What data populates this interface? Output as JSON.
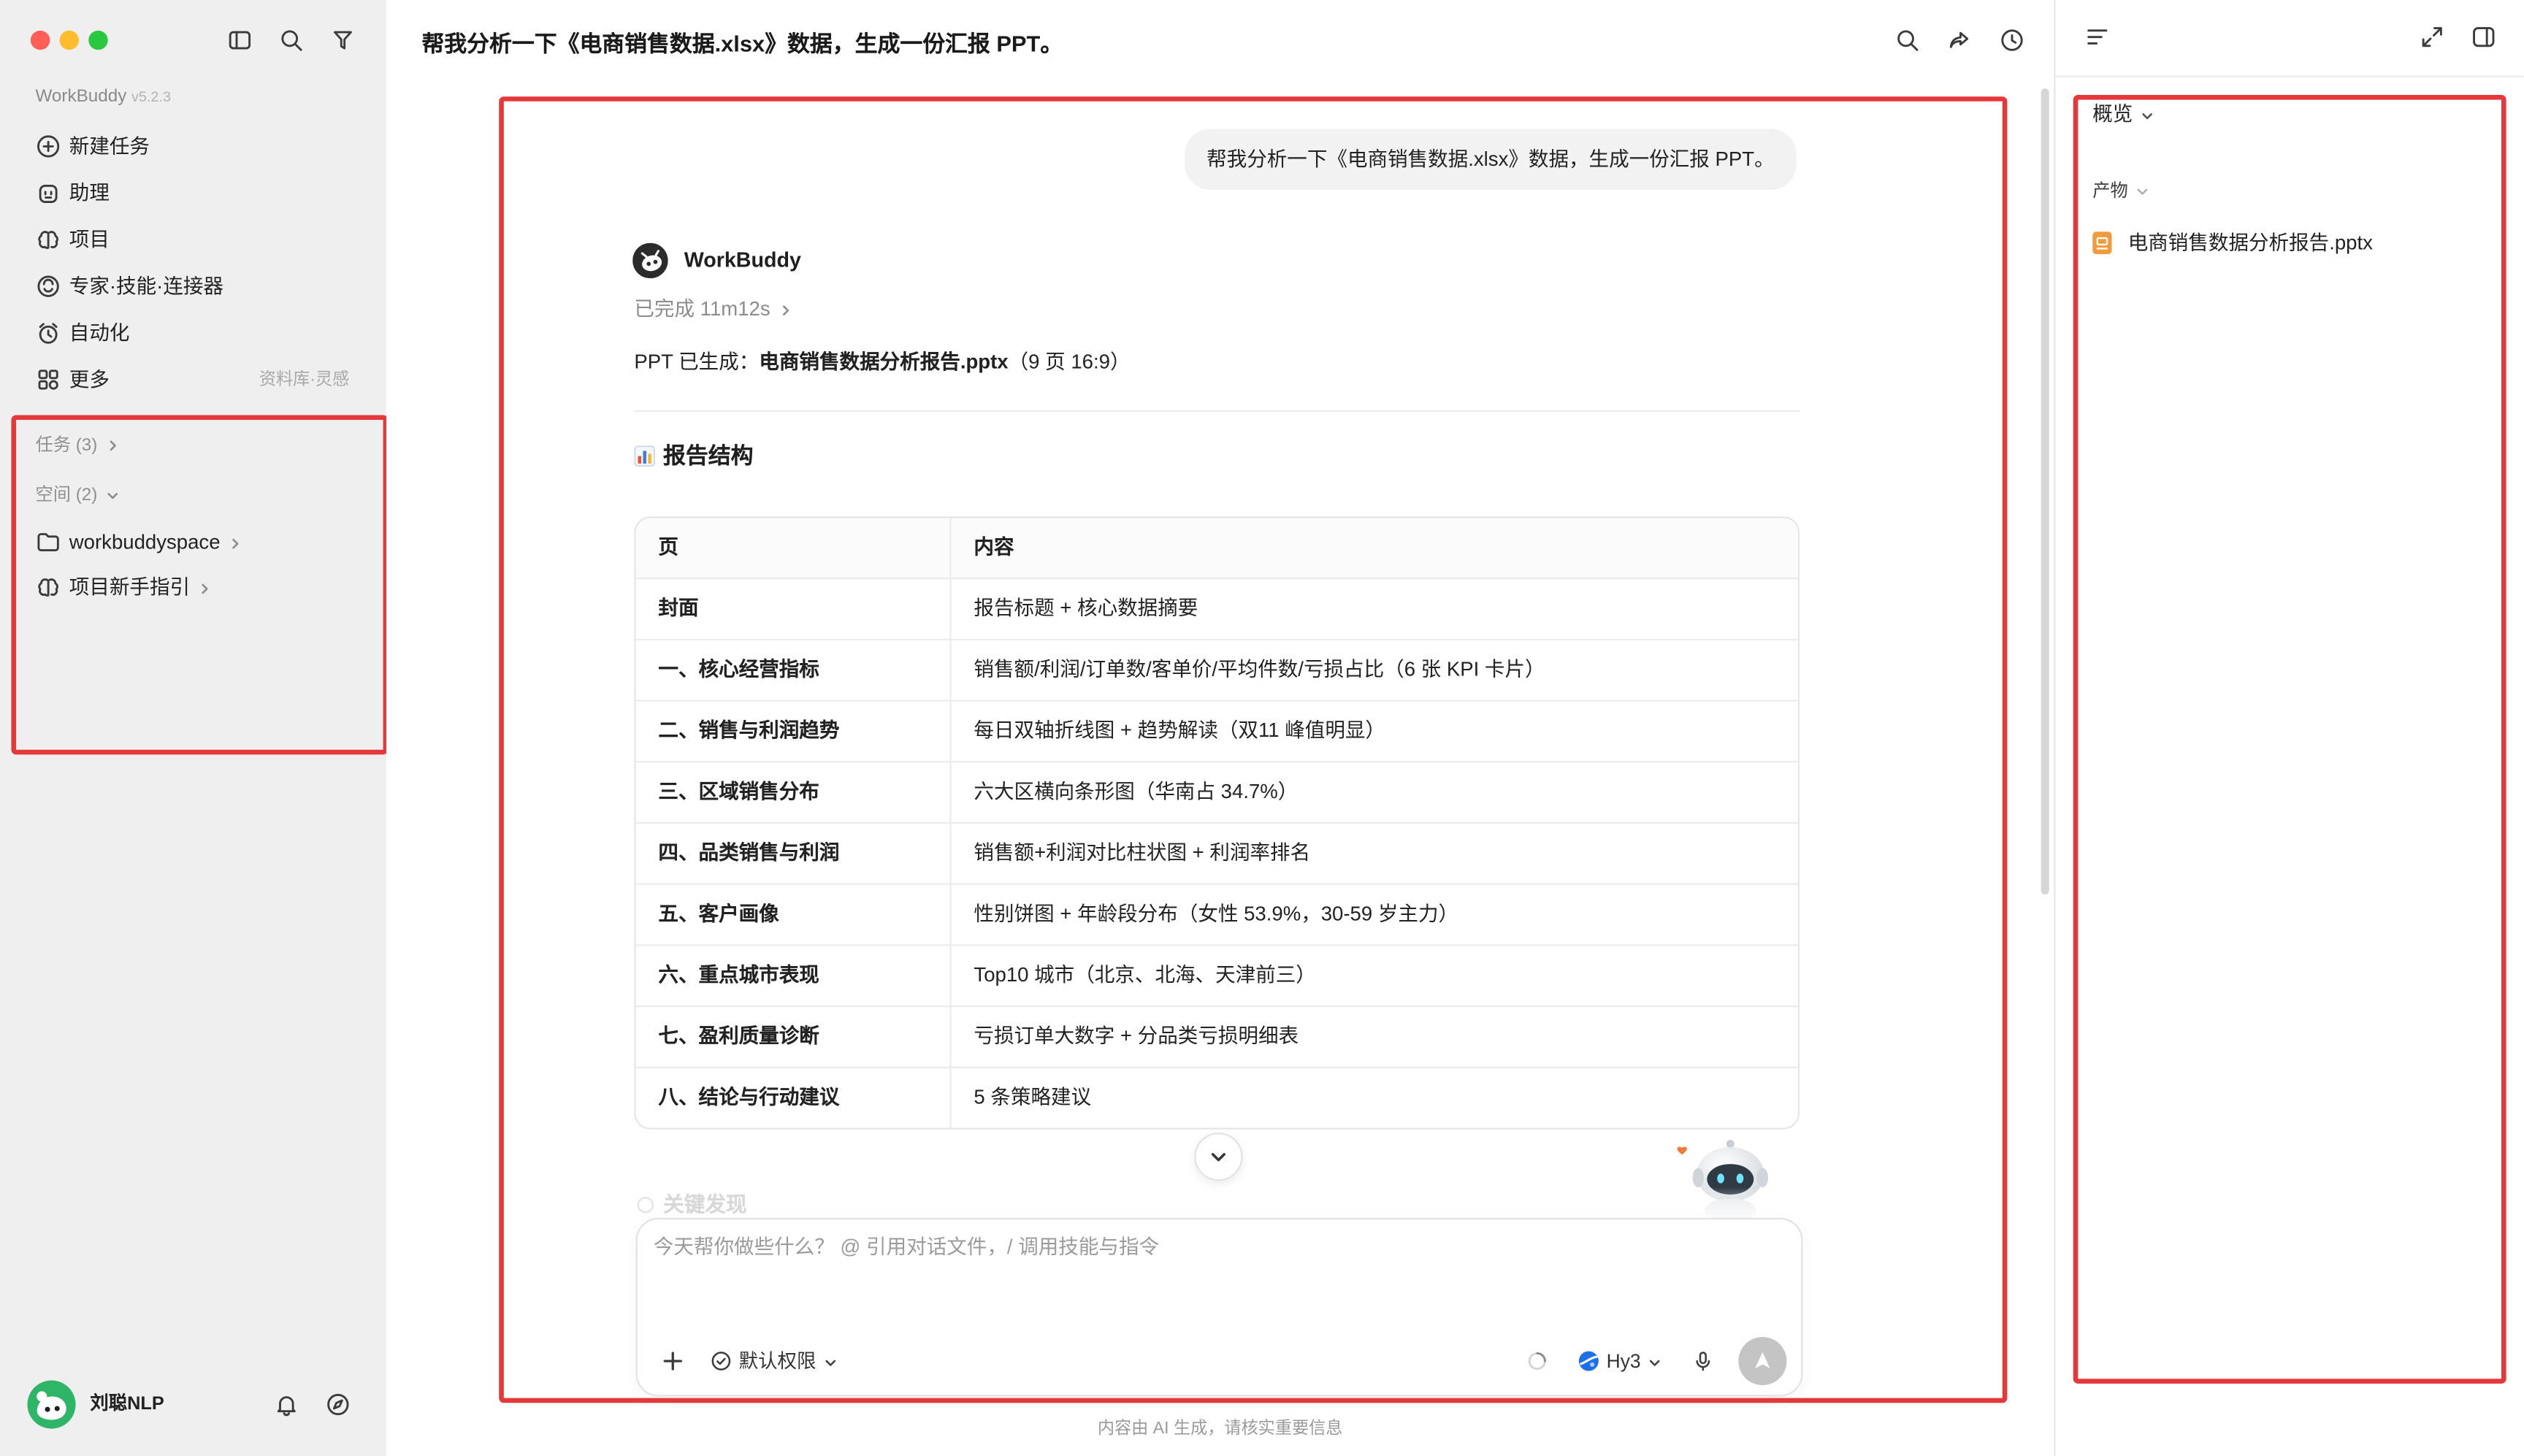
{
  "colors": {
    "highlight_red": "#e5383b",
    "sidebar_bg": "#efefef",
    "traffic_close": "#ff5f57",
    "traffic_minimize": "#febc2e",
    "traffic_zoom": "#28c840",
    "user_bubble_bg": "#f2f2f2",
    "file_icon_orange": "#f39a3c",
    "model_icon_blue": "#1f6feb",
    "send_button_gray": "#c4c4c4",
    "avatar_green": "#2fb567"
  },
  "sidebar": {
    "app_name": "WorkBuddy",
    "version": "v5.2.3",
    "toolbar_icons": [
      "sidebar-toggle-icon",
      "search-icon",
      "filter-icon"
    ],
    "nav": [
      {
        "label": "新建任务",
        "icon": "plus-circle-icon"
      },
      {
        "label": "助理",
        "icon": "assistant-icon"
      },
      {
        "label": "项目",
        "icon": "project-icon"
      },
      {
        "label": "专家·技能·连接器",
        "icon": "expert-icon"
      },
      {
        "label": "自动化",
        "icon": "alarm-clock-icon"
      },
      {
        "label": "更多",
        "icon": "grid-icon",
        "hint": "资料库·灵感"
      }
    ],
    "tasks_label": "任务 (3)",
    "spaces_label": "空间 (2)",
    "spaces": [
      {
        "label": "workbuddyspace",
        "icon": "folder-icon"
      },
      {
        "label": "项目新手指引",
        "icon": "project-icon"
      }
    ],
    "user": {
      "name": "刘聪NLP",
      "icons": [
        "bell-icon",
        "compass-icon"
      ]
    }
  },
  "header": {
    "title": "帮我分析一下《电商销售数据.xlsx》数据，生成一份汇报 PPT。",
    "icons": [
      "search-icon",
      "share-icon",
      "history-icon"
    ]
  },
  "chat": {
    "user_message": "帮我分析一下《电商销售数据.xlsx》数据，生成一份汇报 PPT。",
    "assistant_name": "WorkBuddy",
    "status": "已完成 11m12s",
    "result_prefix": "PPT 已生成：",
    "result_file": "电商销售数据分析报告.pptx",
    "result_suffix": "（9 页 16:9）",
    "section_icon": "bar-chart-icon",
    "section_title": "报告结构",
    "table": {
      "headers": [
        "页",
        "内容"
      ],
      "rows": [
        [
          "封面",
          "报告标题 + 核心数据摘要"
        ],
        [
          "一、核心经营指标",
          "销售额/利润/订单数/客单价/平均件数/亏损占比（6 张 KPI 卡片）"
        ],
        [
          "二、销售与利润趋势",
          "每日双轴折线图 + 趋势解读（双11 峰值明显）"
        ],
        [
          "三、区域销售分布",
          "六大区横向条形图（华南占 34.7%）"
        ],
        [
          "四、品类销售与利润",
          "销售额+利润对比柱状图 + 利润率排名"
        ],
        [
          "五、客户画像",
          "性别饼图 + 年龄段分布（女性 53.9%，30-59 岁主力）"
        ],
        [
          "六、重点城市表现",
          "Top10 城市（北京、北海、天津前三）"
        ],
        [
          "七、盈利质量诊断",
          "亏损订单大数字 + 分品类亏损明细表"
        ],
        [
          "八、结论与行动建议",
          "5 条策略建议"
        ]
      ]
    },
    "faded_next_heading": "关键发现"
  },
  "composer": {
    "placeholder": "今天帮你做些什么？ @ 引用对话文件，/ 调用技能与指令",
    "permission_label": "默认权限",
    "model_label": "Hy3"
  },
  "footer": {
    "disclaimer": "内容由 AI 生成，请核实重要信息"
  },
  "right_panel": {
    "overview_label": "概览",
    "artifacts_label": "产物",
    "files": [
      {
        "name": "电商销售数据分析报告.pptx",
        "icon": "pptx-file-icon"
      }
    ]
  }
}
